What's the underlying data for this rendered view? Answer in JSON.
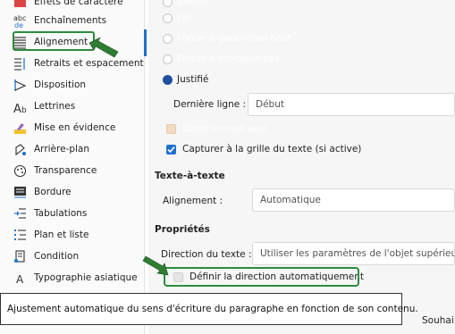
{
  "sidebar": {
    "items": [
      {
        "label": "Effets de caractère",
        "icon": "character-effects-icon"
      },
      {
        "label": "Enchaînements",
        "icon": "text-flow-icon"
      },
      {
        "label": "Alignement",
        "icon": "alignment-icon"
      },
      {
        "label": "Retraits et espacement",
        "icon": "indents-spacing-icon"
      },
      {
        "label": "Disposition",
        "icon": "position-icon"
      },
      {
        "label": "Lettrines",
        "icon": "drop-caps-icon"
      },
      {
        "label": "Mise en évidence",
        "icon": "highlighting-icon"
      },
      {
        "label": "Arrière-plan",
        "icon": "background-icon"
      },
      {
        "label": "Transparence",
        "icon": "transparency-icon"
      },
      {
        "label": "Bordure",
        "icon": "border-icon"
      },
      {
        "label": "Tabulations",
        "icon": "tabs-icon"
      },
      {
        "label": "Plan et liste",
        "icon": "outline-list-icon"
      },
      {
        "label": "Condition",
        "icon": "condition-icon"
      },
      {
        "label": "Typographie asiatique",
        "icon": "asian-typography-icon"
      }
    ]
  },
  "alignment": {
    "options": [
      {
        "label": "Centré",
        "checked": false
      },
      {
        "label": "Fin",
        "checked": false
      },
      {
        "label": "Forcer à gauche/en haut",
        "checked": false
      },
      {
        "label": "Forcer à droite/en bas",
        "checked": false
      },
      {
        "label": "Justifié",
        "checked": true
      }
    ],
    "last_line_label": "Dernière ligne :",
    "last_line_value": "Début",
    "expand_single_word": "Étirer un mot seul",
    "snap_to_grid": "Capturer à la grille du texte (si active)"
  },
  "text_to_text": {
    "title": "Texte-à-texte",
    "alignment_label": "Alignement :",
    "alignment_value": "Automatique"
  },
  "properties": {
    "title": "Propriétés",
    "direction_label": "Direction du texte :",
    "direction_value": "Utiliser les paramètres de l'objet supérieur",
    "auto_direction": "Définir la direction automatiquement"
  },
  "tooltip": "Ajustement automatique du sens d'écriture du paragraphe en fonction de son contenu.",
  "bottom_text": "Souhai",
  "colors": {
    "accent": "#1f6fd0",
    "highlight": "#2e8b3c"
  }
}
